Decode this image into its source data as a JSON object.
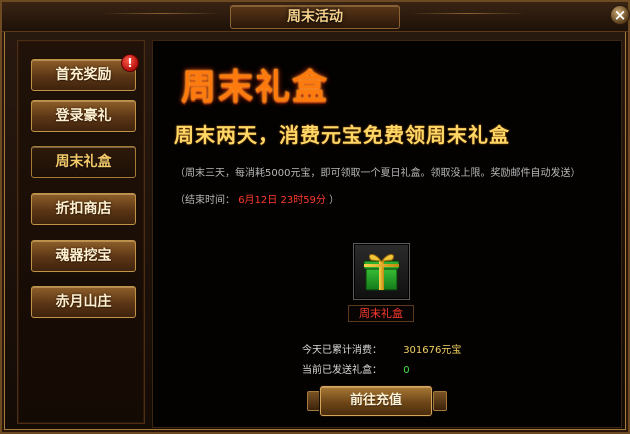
{
  "window": {
    "title": "周末活动"
  },
  "sidebar": {
    "items": [
      {
        "label": "首充奖励",
        "active": false
      },
      {
        "label": "登录豪礼",
        "active": false,
        "badge": "!"
      },
      {
        "label": "周末礼盒",
        "active": true
      },
      {
        "label": "折扣商店",
        "active": false
      },
      {
        "label": "魂器挖宝",
        "active": false
      },
      {
        "label": "赤月山庄",
        "active": false
      }
    ]
  },
  "main": {
    "banner_title": "周末礼盒",
    "subtitle": "周末两天，消费元宝免费领周末礼盒",
    "description": "（周末三天，每消耗5000元宝，即可领取一个夏日礼盒。领取没上限。奖励邮件自动发送）",
    "end_time": {
      "prefix": "（结束时间：",
      "date": "6月12日",
      "time": "23时59分",
      "suffix": "）"
    },
    "gift": {
      "label": "周末礼盒",
      "icon": "gift-box-icon"
    },
    "stats": {
      "spent_label": "今天已累计消费：",
      "spent_value": "301676元宝",
      "sent_label": "当前已发送礼盒：",
      "sent_value": "0"
    },
    "claim_button": "前往充值"
  },
  "colors": {
    "banner_orange": "#ff7a0d",
    "subtitle_gold": "#ffd766",
    "accent_red": "#ff3b2f",
    "button_bronze": "#8e5f29"
  }
}
